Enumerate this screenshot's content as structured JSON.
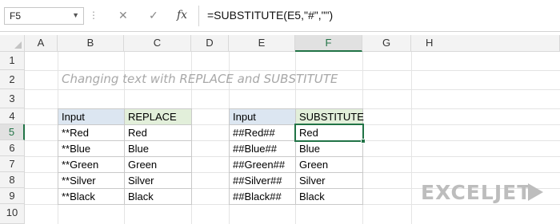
{
  "formula_bar": {
    "name_box": "F5",
    "dots": "⋮",
    "cancel_icon": "✕",
    "enter_icon": "✓",
    "fx_label": "fx",
    "formula": "=SUBSTITUTE(E5,\"#\",\"\")"
  },
  "columns": [
    "A",
    "B",
    "C",
    "D",
    "E",
    "F",
    "G",
    "H"
  ],
  "selected_column": "F",
  "rows": [
    "1",
    "2",
    "3",
    "4",
    "5",
    "6",
    "7",
    "8",
    "9",
    "10"
  ],
  "selected_row": "5",
  "title": "Changing text with REPLACE and SUBSTITUTE",
  "table_replace": {
    "headers": [
      "Input",
      "REPLACE"
    ],
    "rows": [
      [
        "**Red",
        "Red"
      ],
      [
        "**Blue",
        "Blue"
      ],
      [
        "**Green",
        "Green"
      ],
      [
        "**Silver",
        "Silver"
      ],
      [
        "**Black",
        "Black"
      ]
    ]
  },
  "table_substitute": {
    "headers": [
      "Input",
      "SUBSTITUTE"
    ],
    "rows": [
      [
        "##Red##",
        "Red"
      ],
      [
        "##Blue##",
        "Blue"
      ],
      [
        "##Green##",
        "Green"
      ],
      [
        "##Silver##",
        "Silver"
      ],
      [
        "##Black##",
        "Black"
      ]
    ]
  },
  "logo_text": "EXCELJET",
  "colors": {
    "accent": "#217346",
    "input_header": "#dce6f1",
    "result_header": "#e2efda",
    "title_text": "#a8a8a8"
  }
}
